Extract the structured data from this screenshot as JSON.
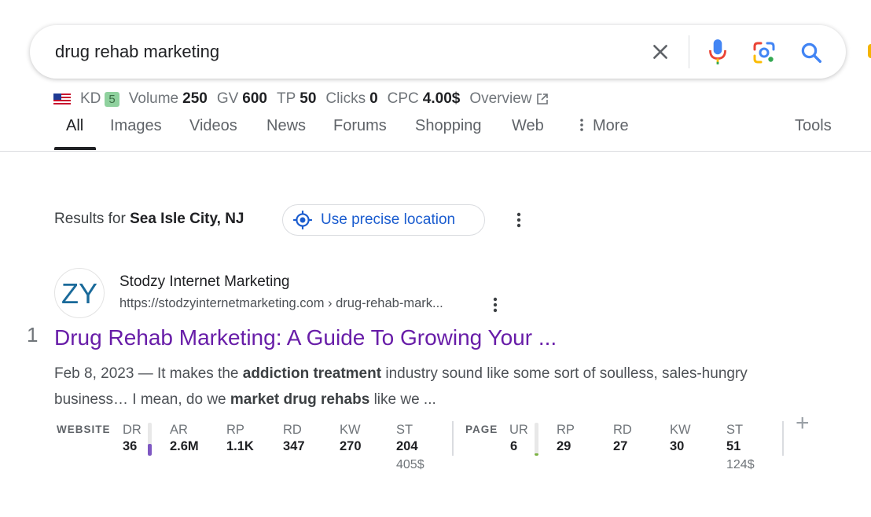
{
  "search": {
    "query": "drug rehab marketing",
    "colors": {
      "mic_blue": "#4285f4",
      "mic_red": "#ea4335",
      "lens_green": "#34a853",
      "lens_yellow": "#fbbc04"
    }
  },
  "metrics": {
    "kd_label": "KD",
    "kd_value": "5",
    "volume_label": "Volume",
    "volume_value": "250",
    "gv_label": "GV",
    "gv_value": "600",
    "tp_label": "TP",
    "tp_value": "50",
    "clicks_label": "Clicks",
    "clicks_value": "0",
    "cpc_label": "CPC",
    "cpc_value": "4.00$",
    "overview_label": "Overview"
  },
  "tabs": [
    {
      "label": "All",
      "active": true
    },
    {
      "label": "Images"
    },
    {
      "label": "Videos"
    },
    {
      "label": "News"
    },
    {
      "label": "Forums"
    },
    {
      "label": "Shopping"
    },
    {
      "label": "Web"
    },
    {
      "label": "More"
    },
    {
      "label": "Tools"
    }
  ],
  "location": {
    "prefix": "Results for ",
    "place": "Sea Isle City, NJ",
    "precise_button": "Use precise location"
  },
  "result": {
    "rank": "1",
    "favicon_text": "ZY",
    "site_name": "Stodzy Internet Marketing",
    "url": "https://stodzyinternetmarketing.com › drug-rehab-mark...",
    "title": "Drug Rehab Marketing: A Guide To Growing Your ...",
    "snippet": {
      "p1": "Feb 8, 2023 — It makes the ",
      "b1": "addiction treatment",
      "p2": " industry sound like some sort of soulless, sales-hungry business… I mean, do we ",
      "b2": "market drug rehabs",
      "p3": " like we ..."
    }
  },
  "seo": {
    "website_label": "WEBSITE",
    "page_label": "PAGE",
    "plus": "+",
    "dr": {
      "label": "DR",
      "value": "36",
      "bar_fraction": 0.36,
      "bar_color": "#7e57c2"
    },
    "ar": {
      "label": "AR",
      "value": "2.6M"
    },
    "rp_site": {
      "label": "RP",
      "value": "1.1K"
    },
    "rd_site": {
      "label": "RD",
      "value": "347"
    },
    "kw_site": {
      "label": "KW",
      "value": "270"
    },
    "st_site": {
      "label": "ST",
      "value": "204",
      "sub": "405$"
    },
    "ur": {
      "label": "UR",
      "value": "6",
      "bar_fraction": 0.06,
      "bar_color": "#7cb342"
    },
    "rp_page": {
      "label": "RP",
      "value": "29"
    },
    "rd_page": {
      "label": "RD",
      "value": "27"
    },
    "kw_page": {
      "label": "KW",
      "value": "30"
    },
    "st_page": {
      "label": "ST",
      "value": "51",
      "sub": "124$"
    }
  }
}
